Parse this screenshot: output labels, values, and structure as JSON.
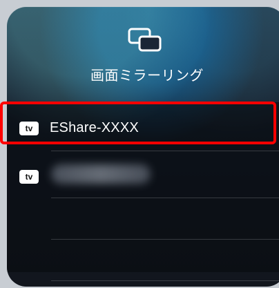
{
  "header": {
    "icon": "screen-mirroring-icon",
    "title": "画面ミラーリング"
  },
  "devices": [
    {
      "icon": "apple-tv-icon",
      "icon_label": "tv",
      "name": "EShare-XXXX",
      "selected": true
    },
    {
      "icon": "apple-tv-icon",
      "icon_label": "tv",
      "name": "",
      "obscured": true
    }
  ],
  "colors": {
    "highlight": "#ff0000",
    "text": "#ffffff"
  }
}
